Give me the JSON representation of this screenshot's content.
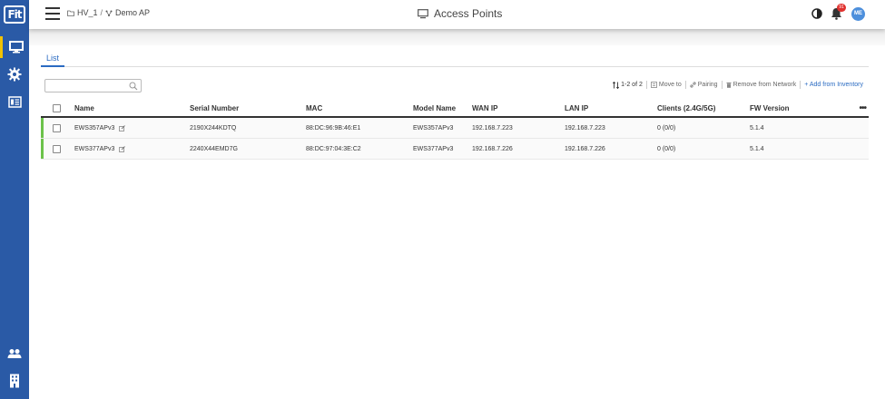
{
  "sidebar": {
    "logo": "Fit",
    "items": [
      {
        "icon": "monitor-icon",
        "active": true
      },
      {
        "icon": "gear-icon",
        "active": false
      },
      {
        "icon": "list-icon",
        "active": false
      }
    ],
    "bottom_items": [
      {
        "icon": "users-icon"
      },
      {
        "icon": "building-icon"
      }
    ]
  },
  "header": {
    "breadcrumb": [
      {
        "icon": "folder-icon",
        "label": "HV_1"
      },
      {
        "icon": "network-icon",
        "label": "Demo AP"
      }
    ],
    "breadcrumb_separator": "/",
    "title": "Access Points",
    "notification_count": "91",
    "avatar_initials": "ME"
  },
  "tabs": [
    {
      "label": "List",
      "active": true
    }
  ],
  "search": {
    "placeholder": "",
    "value": ""
  },
  "toolbar": {
    "count": "1-2 of 2",
    "move_to": "Move to",
    "pairing": "Pairing",
    "remove": "Remove from Network",
    "add": "+ Add from Inventory"
  },
  "table": {
    "columns": [
      "Name",
      "Serial Number",
      "MAC",
      "Model Name",
      "WAN IP",
      "LAN IP",
      "Clients (2.4G/5G)",
      "FW Version"
    ],
    "more": "•••",
    "rows": [
      {
        "name": "EWS357APv3",
        "serial": "2190X244KDTQ",
        "mac": "88:DC:96:9B:46:E1",
        "model": "EWS357APv3",
        "wan_ip": "192.168.7.223",
        "lan_ip": "192.168.7.223",
        "clients": "0 (0/0)",
        "fw": "5.1.4",
        "status_color": "#6cc24a"
      },
      {
        "name": "EWS377APv3",
        "serial": "2240X44EMD7G",
        "mac": "88:DC:97:04:3E:C2",
        "model": "EWS377APv3",
        "wan_ip": "192.168.7.226",
        "lan_ip": "192.168.7.226",
        "clients": "0 (0/0)",
        "fw": "5.1.4",
        "status_color": "#6cc24a"
      }
    ]
  },
  "colors": {
    "sidebar": "#2a5aa6",
    "accent": "#2a6bc2",
    "active_indicator": "#f2c200",
    "online": "#6cc24a",
    "badge": "#e0322f"
  }
}
